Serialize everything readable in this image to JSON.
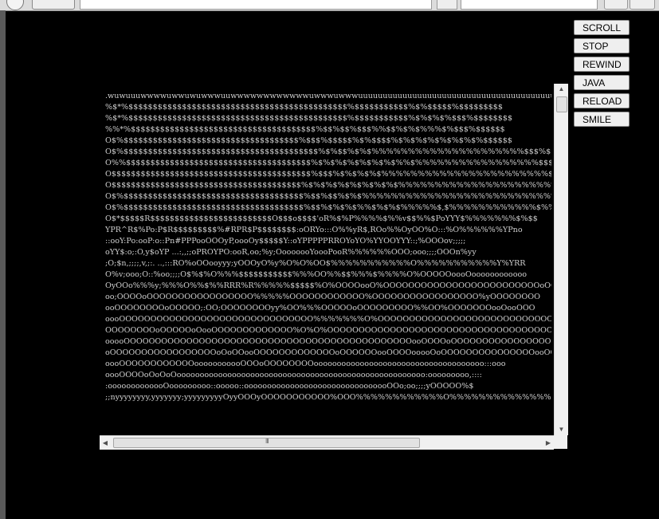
{
  "controls": {
    "buttons": [
      "SCROLL",
      "STOP",
      "REWIND",
      "JAVA",
      "RELOAD",
      "SMILE"
    ]
  },
  "ascii_lines": [
    ".wuwuuuwwwwuwwuwuwwwuuwwwwwwwwwwwwuwwwuwwwuuuuuuuuuuuuuuuuuuuuuuuuuuuuuuuuuuuuuuuu",
    "%$*%$$$$$$$$$$$$$$$$$$$$$$$$$$$$$$$$$$$$$$$$$$$$$%$$$$$$$$$$$%$%$$$$$%$$$$$$$$$",
    "%$*%$$$$$$$$$$$$$$$$$$$$$$$$$$$$$$$$$$$$$$$$$$$$$%$$$$$$$$$$$%$%$%$%$$$%$$$$$$$$",
    "%%*%$$$$$$$$$$$$$$$$$$$$$$$$$$$$$$$$$$$$$$%$$%$$%$$$%%$$%$%$%%%$%$$$%$$$$$$",
    "O$%$$$$$$$$$$$$$$$$$$$$$$$$$$$$$$$$$$$$%$$$%$$$$$%$%$$$$%$%$%$%$%$%$%$%$$$$$$",
    "O$%$$$$$$$$$$$$$$$$$$$$$$$$$$$$$$$$$$$$$$$$%$%$$%$%$%%%%%%%%%%%%%%%%%%%%%$$$%$$",
    "O%%$$$$$$$$$$$$$$$$$$$$$$$$$$$$$$$$$$$$$$%$%$%$%$%$%$%$%%$%%%%%%%%%%%%%%%%%$$$$",
    "O$$$$$$$$$$$$$$$$$$$$$$$$$$$$$$$$$$$$$$$$$%$$$%$%$%$%$%%%%%%%%%%%%%%%%%%%%%%%$$$",
    "O$$$$$$$$$$$$$$$$$$$$$$$$$$$$$$$$$$$$$$$%$%$%$%$%$%$%$%$%%%%%%%%%%%%%%%%%%%%%%%$",
    "O$%$$$$$$$$$$$$$$$$$$$$$$$$$$$$$$$$$$$$$%$$%$$%$%$%%%%%%%%%%%%%%%%%%%%%%%%%%%$%$",
    "O$%$$$$$$$$$$$$$$$$$$$$$$$$$$$$$$$$$$$$$%$$%$%$%$%%$%$%$%%%%%$,$%%%%%%%%%%%%$%%",
    "O$*$$$$$R$$$$$$$$$$$$$$$$$$$$$$$$$O$$$o$$$$'oR%$%P%%%%$%%v$$%%$PoYYY$%%%%%%%$%$$",
    "YPR^R$%Po:P$R$$$$$$$$$%#RPR$P$$$$$$$$:oORYo:::O%%yR$,ROo%%OyOO%O:::%O%%%%%%YPno",
    "::ooY:Po:ooP:o::Pn#PPPooOOOyP,oooOy$$$$$Y::oYPPPPPRROYoYO%YYOOYYY::;%OOOov;;;;;",
    "oYY$:o;:O,y$oYP ...:,,;;oPROYPO:ooR,oo;%y;OooooooYoooPooR%%%%%%OOO;ooo;;;;OOOn%yy",
    ";O;$n,;;;;,v,;:. ..,:::RO%oOOooyyy;yOOOyO%y%O%O%OO$%%%%%%%%%%%O%%%%%%%%%%%Y%YRR",
    "O%v;ooo;O::%oo;;;;O$%$%O%%%$$$$$$$$$$$%%%OO%%$$%%%$%%%%O%OOOOOoooOoooooooooooo",
    "OyOOo%%%y;%%%O%%$%%RRR%R%%%%%$$$$$%O%OOOOooO%OOOOOOOOOOOOOOOOOOOOOOOOOoOO",
    "oo;OOOOoOOOOOOOOOOOOOOOOO%%%%%OOOOOOOOOOOO%OOOOOOOOOOOOOOOOO%yOOOOOOOO",
    "ooOOOOOOOOoOOOOO;:OO;OOOOOOOOyy%OO%%%OOOOOoOOOOOOOOO%%OO%OOOOOOOooOooOOO",
    "oooOOOOOOOOOOOOOOOOOOOOOOOOOOOOOOO%%%%%%%O%OOOOOOOOOOOOOOOOOOOOOOOOOOOOO",
    "OOOOOOOOoOOOOOoOooOOOOOOOOOOOOO%O%O%OOOOOOOOOOOOOOOOOOOOOOOOOOOOOOOOOOOOOoOO",
    "ooooOOOOOOOOOOOOOOOOOOOOOOOOOOOOOOOOOOOOOOOOOOOOOOooOOOOoOOOOOOOOOOOOOOOOOOOOO",
    "oOOOOOOOOOOOOOOOOOoOoOOooOOOOOOOOOOOOOoOOOOOOooOOOOooooOoOOOOOOOOOOOOOOOooOOOO",
    "oooOOOOOOOOOOOOooooooooooOOOoOOOOOOOOooooooooooooooooooooooooooooooooooooo:::ooo",
    "oooOOOOoOoOoOoooooooooooooooooooooooooooooooooooooooooooooooooooooo:ooooooooo,::::",
    ":ooooooooooooOooooooooo::ooooo::oooooooooooooooooooooooooooooooOOo;oo;;;;yOOOOO%$",
    ";;nyyyyyyyy,yyyyyyy;yyyyyyyyyOyyOOOyOOOOOOOOOOO%OOO%%%%%%%%%%%%O%%%%%%%%%%%%%%%"
  ],
  "hscroll": {
    "grip": "III"
  }
}
